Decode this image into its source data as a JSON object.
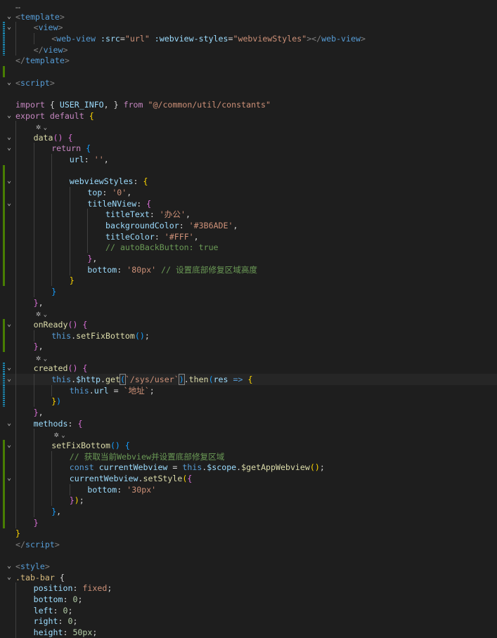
{
  "lines": [
    {
      "indent": 0,
      "fold": "",
      "gutter": "",
      "tokens": [
        {
          "t": "…",
          "c": "tok-punc"
        }
      ]
    },
    {
      "indent": 0,
      "fold": "⌄",
      "gutter": "",
      "tokens": [
        {
          "t": "<",
          "c": "tok-punc"
        },
        {
          "t": "template",
          "c": "tok-tag"
        },
        {
          "t": ">",
          "c": "tok-punc"
        }
      ]
    },
    {
      "indent": 1,
      "fold": "⌄",
      "gutter": "mod",
      "tokens": [
        {
          "t": "<",
          "c": "tok-punc"
        },
        {
          "t": "view",
          "c": "tok-tag"
        },
        {
          "t": ">",
          "c": "tok-punc"
        }
      ]
    },
    {
      "indent": 2,
      "fold": "",
      "gutter": "mod",
      "tokens": [
        {
          "t": "<",
          "c": "tok-punc"
        },
        {
          "t": "web-view",
          "c": "tok-tag"
        },
        {
          "t": " :src",
          "c": "tok-attr"
        },
        {
          "t": "=",
          "c": "tok-plain"
        },
        {
          "t": "\"url\"",
          "c": "tok-str"
        },
        {
          "t": " :webview-styles",
          "c": "tok-attr"
        },
        {
          "t": "=",
          "c": "tok-plain"
        },
        {
          "t": "\"webviewStyles\"",
          "c": "tok-str"
        },
        {
          "t": "></",
          "c": "tok-punc"
        },
        {
          "t": "web-view",
          "c": "tok-tag"
        },
        {
          "t": ">",
          "c": "tok-punc"
        }
      ]
    },
    {
      "indent": 1,
      "fold": "",
      "gutter": "mod",
      "tokens": [
        {
          "t": "</",
          "c": "tok-punc"
        },
        {
          "t": "view",
          "c": "tok-tag"
        },
        {
          "t": ">",
          "c": "tok-punc"
        }
      ]
    },
    {
      "indent": 0,
      "fold": "",
      "gutter": "",
      "tokens": [
        {
          "t": "</",
          "c": "tok-punc"
        },
        {
          "t": "template",
          "c": "tok-tag"
        },
        {
          "t": ">",
          "c": "tok-punc"
        }
      ]
    },
    {
      "indent": 0,
      "fold": "",
      "gutter": "add",
      "tokens": []
    },
    {
      "indent": 0,
      "fold": "⌄",
      "gutter": "",
      "tokens": [
        {
          "t": "<",
          "c": "tok-punc"
        },
        {
          "t": "script",
          "c": "tok-tag"
        },
        {
          "t": ">",
          "c": "tok-punc"
        }
      ]
    },
    {
      "indent": 0,
      "fold": "",
      "gutter": "",
      "tokens": []
    },
    {
      "indent": 0,
      "fold": "",
      "gutter": "",
      "tokens": [
        {
          "t": "import",
          "c": "tok-kw"
        },
        {
          "t": " { ",
          "c": "tok-plain"
        },
        {
          "t": "USER_INFO",
          "c": "tok-var"
        },
        {
          "t": ", } ",
          "c": "tok-plain"
        },
        {
          "t": "from",
          "c": "tok-kw"
        },
        {
          "t": " ",
          "c": "tok-plain"
        },
        {
          "t": "\"@/common/util/constants\"",
          "c": "tok-str"
        }
      ]
    },
    {
      "indent": 0,
      "fold": "⌄",
      "gutter": "",
      "tokens": [
        {
          "t": "export",
          "c": "tok-kw"
        },
        {
          "t": " ",
          "c": "tok-plain"
        },
        {
          "t": "default",
          "c": "tok-kw"
        },
        {
          "t": " ",
          "c": "tok-plain"
        },
        {
          "t": "{",
          "c": "tok-br1"
        }
      ]
    },
    {
      "indent": 1,
      "fold": "",
      "gutter": "",
      "lens": true,
      "tokens": []
    },
    {
      "indent": 1,
      "fold": "⌄",
      "gutter": "",
      "tokens": [
        {
          "t": "data",
          "c": "tok-fn"
        },
        {
          "t": "()",
          "c": "tok-br2"
        },
        {
          "t": " ",
          "c": "tok-plain"
        },
        {
          "t": "{",
          "c": "tok-br2"
        }
      ]
    },
    {
      "indent": 2,
      "fold": "⌄",
      "gutter": "",
      "tokens": [
        {
          "t": "return",
          "c": "tok-kw"
        },
        {
          "t": " ",
          "c": "tok-plain"
        },
        {
          "t": "{",
          "c": "tok-br3"
        }
      ]
    },
    {
      "indent": 3,
      "fold": "",
      "gutter": "",
      "tokens": [
        {
          "t": "url",
          "c": "tok-prop"
        },
        {
          "t": ": ",
          "c": "tok-plain"
        },
        {
          "t": "''",
          "c": "tok-str"
        },
        {
          "t": ",",
          "c": "tok-plain"
        }
      ]
    },
    {
      "indent": 3,
      "fold": "",
      "gutter": "add",
      "tokens": []
    },
    {
      "indent": 3,
      "fold": "⌄",
      "gutter": "add",
      "tokens": [
        {
          "t": "webviewStyles",
          "c": "tok-prop"
        },
        {
          "t": ": ",
          "c": "tok-plain"
        },
        {
          "t": "{",
          "c": "tok-br1"
        }
      ]
    },
    {
      "indent": 4,
      "fold": "",
      "gutter": "add",
      "tokens": [
        {
          "t": "top",
          "c": "tok-prop"
        },
        {
          "t": ": ",
          "c": "tok-plain"
        },
        {
          "t": "'0'",
          "c": "tok-str"
        },
        {
          "t": ",",
          "c": "tok-plain"
        }
      ]
    },
    {
      "indent": 4,
      "fold": "⌄",
      "gutter": "add",
      "tokens": [
        {
          "t": "titleNView",
          "c": "tok-prop"
        },
        {
          "t": ": ",
          "c": "tok-plain"
        },
        {
          "t": "{",
          "c": "tok-br2"
        }
      ]
    },
    {
      "indent": 5,
      "fold": "",
      "gutter": "add",
      "tokens": [
        {
          "t": "titleText",
          "c": "tok-prop"
        },
        {
          "t": ": ",
          "c": "tok-plain"
        },
        {
          "t": "'办公'",
          "c": "tok-str"
        },
        {
          "t": ",",
          "c": "tok-plain"
        }
      ]
    },
    {
      "indent": 5,
      "fold": "",
      "gutter": "add",
      "tokens": [
        {
          "t": "backgroundColor",
          "c": "tok-prop"
        },
        {
          "t": ": ",
          "c": "tok-plain"
        },
        {
          "t": "'#3B6ADE'",
          "c": "tok-str"
        },
        {
          "t": ",",
          "c": "tok-plain"
        }
      ]
    },
    {
      "indent": 5,
      "fold": "",
      "gutter": "add",
      "tokens": [
        {
          "t": "titleColor",
          "c": "tok-prop"
        },
        {
          "t": ": ",
          "c": "tok-plain"
        },
        {
          "t": "'#FFF'",
          "c": "tok-str"
        },
        {
          "t": ",",
          "c": "tok-plain"
        }
      ]
    },
    {
      "indent": 5,
      "fold": "",
      "gutter": "add",
      "tokens": [
        {
          "t": "// autoBackButton: true",
          "c": "tok-com"
        }
      ]
    },
    {
      "indent": 4,
      "fold": "",
      "gutter": "add",
      "tokens": [
        {
          "t": "}",
          "c": "tok-br2"
        },
        {
          "t": ",",
          "c": "tok-plain"
        }
      ]
    },
    {
      "indent": 4,
      "fold": "",
      "gutter": "add",
      "tokens": [
        {
          "t": "bottom",
          "c": "tok-prop"
        },
        {
          "t": ": ",
          "c": "tok-plain"
        },
        {
          "t": "'80px'",
          "c": "tok-str"
        },
        {
          "t": " ",
          "c": "tok-plain"
        },
        {
          "t": "// 设置底部修复区域高度",
          "c": "tok-com"
        }
      ]
    },
    {
      "indent": 3,
      "fold": "",
      "gutter": "add",
      "tokens": [
        {
          "t": "}",
          "c": "tok-br1"
        }
      ]
    },
    {
      "indent": 2,
      "fold": "",
      "gutter": "",
      "tokens": [
        {
          "t": "}",
          "c": "tok-br3"
        }
      ]
    },
    {
      "indent": 1,
      "fold": "",
      "gutter": "",
      "tokens": [
        {
          "t": "}",
          "c": "tok-br2"
        },
        {
          "t": ",",
          "c": "tok-plain"
        }
      ]
    },
    {
      "indent": 1,
      "fold": "",
      "gutter": "",
      "lens": true,
      "tokens": []
    },
    {
      "indent": 1,
      "fold": "⌄",
      "gutter": "add",
      "tokens": [
        {
          "t": "onReady",
          "c": "tok-fn"
        },
        {
          "t": "()",
          "c": "tok-br2"
        },
        {
          "t": " ",
          "c": "tok-plain"
        },
        {
          "t": "{",
          "c": "tok-br2"
        }
      ]
    },
    {
      "indent": 2,
      "fold": "",
      "gutter": "add",
      "tokens": [
        {
          "t": "this",
          "c": "tok-kwb"
        },
        {
          "t": ".",
          "c": "tok-plain"
        },
        {
          "t": "setFixBottom",
          "c": "tok-fn"
        },
        {
          "t": "()",
          "c": "tok-br3"
        },
        {
          "t": ";",
          "c": "tok-plain"
        }
      ]
    },
    {
      "indent": 1,
      "fold": "",
      "gutter": "add",
      "tokens": [
        {
          "t": "}",
          "c": "tok-br2"
        },
        {
          "t": ",",
          "c": "tok-plain"
        }
      ]
    },
    {
      "indent": 1,
      "fold": "",
      "gutter": "",
      "lens": true,
      "tokens": []
    },
    {
      "indent": 1,
      "fold": "⌄",
      "gutter": "mod",
      "tokens": [
        {
          "t": "created",
          "c": "tok-fn"
        },
        {
          "t": "()",
          "c": "tok-br2"
        },
        {
          "t": " ",
          "c": "tok-plain"
        },
        {
          "t": "{",
          "c": "tok-br2"
        }
      ]
    },
    {
      "indent": 2,
      "fold": "⌄",
      "gutter": "mod",
      "cursor": true,
      "tokens": [
        {
          "t": "this",
          "c": "tok-kwb"
        },
        {
          "t": ".",
          "c": "tok-plain"
        },
        {
          "t": "$http",
          "c": "tok-var"
        },
        {
          "t": ".",
          "c": "tok-plain"
        },
        {
          "t": "get",
          "c": "tok-fn"
        },
        {
          "t": "(",
          "c": "tok-br3",
          "box": true
        },
        {
          "t": "`/sys/user`",
          "c": "tok-str"
        },
        {
          "t": ")",
          "c": "tok-br3",
          "box": true
        },
        {
          "t": ".",
          "c": "tok-plain"
        },
        {
          "t": "then",
          "c": "tok-fn"
        },
        {
          "t": "(",
          "c": "tok-br3"
        },
        {
          "t": "res",
          "c": "tok-var"
        },
        {
          "t": " ",
          "c": "tok-plain"
        },
        {
          "t": "=>",
          "c": "tok-kwb"
        },
        {
          "t": " ",
          "c": "tok-plain"
        },
        {
          "t": "{",
          "c": "tok-br1"
        }
      ]
    },
    {
      "indent": 3,
      "fold": "",
      "gutter": "mod",
      "tokens": [
        {
          "t": "this",
          "c": "tok-kwb"
        },
        {
          "t": ".",
          "c": "tok-plain"
        },
        {
          "t": "url",
          "c": "tok-var"
        },
        {
          "t": " = ",
          "c": "tok-plain"
        },
        {
          "t": "`地址`",
          "c": "tok-str"
        },
        {
          "t": ";",
          "c": "tok-plain"
        }
      ]
    },
    {
      "indent": 2,
      "fold": "",
      "gutter": "mod",
      "tokens": [
        {
          "t": "}",
          "c": "tok-br1"
        },
        {
          "t": ")",
          "c": "tok-br3"
        }
      ]
    },
    {
      "indent": 1,
      "fold": "",
      "gutter": "",
      "tokens": [
        {
          "t": "}",
          "c": "tok-br2"
        },
        {
          "t": ",",
          "c": "tok-plain"
        }
      ]
    },
    {
      "indent": 1,
      "fold": "⌄",
      "gutter": "",
      "tokens": [
        {
          "t": "methods",
          "c": "tok-prop"
        },
        {
          "t": ": ",
          "c": "tok-plain"
        },
        {
          "t": "{",
          "c": "tok-br2"
        }
      ]
    },
    {
      "indent": 2,
      "fold": "",
      "gutter": "",
      "lens": true,
      "tokens": []
    },
    {
      "indent": 2,
      "fold": "⌄",
      "gutter": "add",
      "tokens": [
        {
          "t": "setFixBottom",
          "c": "tok-fn"
        },
        {
          "t": "()",
          "c": "tok-br3"
        },
        {
          "t": " ",
          "c": "tok-plain"
        },
        {
          "t": "{",
          "c": "tok-br3"
        }
      ]
    },
    {
      "indent": 3,
      "fold": "",
      "gutter": "add",
      "tokens": [
        {
          "t": "// 获取当前Webview并设置底部修复区域",
          "c": "tok-com"
        }
      ]
    },
    {
      "indent": 3,
      "fold": "",
      "gutter": "add",
      "tokens": [
        {
          "t": "const",
          "c": "tok-kwb"
        },
        {
          "t": " ",
          "c": "tok-plain"
        },
        {
          "t": "currentWebview",
          "c": "tok-var"
        },
        {
          "t": " = ",
          "c": "tok-plain"
        },
        {
          "t": "this",
          "c": "tok-kwb"
        },
        {
          "t": ".",
          "c": "tok-plain"
        },
        {
          "t": "$scope",
          "c": "tok-var"
        },
        {
          "t": ".",
          "c": "tok-plain"
        },
        {
          "t": "$getAppWebview",
          "c": "tok-fn"
        },
        {
          "t": "()",
          "c": "tok-br1"
        },
        {
          "t": ";",
          "c": "tok-plain"
        }
      ]
    },
    {
      "indent": 3,
      "fold": "⌄",
      "gutter": "add",
      "tokens": [
        {
          "t": "currentWebview",
          "c": "tok-var"
        },
        {
          "t": ".",
          "c": "tok-plain"
        },
        {
          "t": "setStyle",
          "c": "tok-fn"
        },
        {
          "t": "(",
          "c": "tok-br1"
        },
        {
          "t": "{",
          "c": "tok-br2"
        }
      ]
    },
    {
      "indent": 4,
      "fold": "",
      "gutter": "add",
      "tokens": [
        {
          "t": "bottom",
          "c": "tok-prop"
        },
        {
          "t": ": ",
          "c": "tok-plain"
        },
        {
          "t": "'30px'",
          "c": "tok-str"
        }
      ]
    },
    {
      "indent": 3,
      "fold": "",
      "gutter": "add",
      "tokens": [
        {
          "t": "}",
          "c": "tok-br2"
        },
        {
          "t": ")",
          "c": "tok-br1"
        },
        {
          "t": ";",
          "c": "tok-plain"
        }
      ]
    },
    {
      "indent": 2,
      "fold": "",
      "gutter": "add",
      "tokens": [
        {
          "t": "}",
          "c": "tok-br3"
        },
        {
          "t": ",",
          "c": "tok-plain"
        }
      ]
    },
    {
      "indent": 1,
      "fold": "",
      "gutter": "add",
      "tokens": [
        {
          "t": "}",
          "c": "tok-br2"
        }
      ]
    },
    {
      "indent": 0,
      "fold": "",
      "gutter": "",
      "tokens": [
        {
          "t": "}",
          "c": "tok-br1"
        }
      ]
    },
    {
      "indent": 0,
      "fold": "",
      "gutter": "",
      "tokens": [
        {
          "t": "</",
          "c": "tok-punc"
        },
        {
          "t": "script",
          "c": "tok-tag"
        },
        {
          "t": ">",
          "c": "tok-punc"
        }
      ]
    },
    {
      "indent": 0,
      "fold": "",
      "gutter": "",
      "tokens": []
    },
    {
      "indent": 0,
      "fold": "⌄",
      "gutter": "",
      "tokens": [
        {
          "t": "<",
          "c": "tok-punc"
        },
        {
          "t": "style",
          "c": "tok-tag"
        },
        {
          "t": ">",
          "c": "tok-punc"
        }
      ]
    },
    {
      "indent": 0,
      "fold": "⌄",
      "gutter": "",
      "tokens": [
        {
          "t": ".tab-bar",
          "c": "tok-sel"
        },
        {
          "t": " {",
          "c": "tok-plain"
        }
      ]
    },
    {
      "indent": 1,
      "fold": "",
      "gutter": "",
      "tokens": [
        {
          "t": "position",
          "c": "tok-prop-css"
        },
        {
          "t": ": ",
          "c": "tok-plain"
        },
        {
          "t": "fixed",
          "c": "tok-val"
        },
        {
          "t": ";",
          "c": "tok-plain"
        }
      ]
    },
    {
      "indent": 1,
      "fold": "",
      "gutter": "",
      "tokens": [
        {
          "t": "bottom",
          "c": "tok-prop-css"
        },
        {
          "t": ": ",
          "c": "tok-plain"
        },
        {
          "t": "0",
          "c": "tok-num"
        },
        {
          "t": ";",
          "c": "tok-plain"
        }
      ]
    },
    {
      "indent": 1,
      "fold": "",
      "gutter": "",
      "tokens": [
        {
          "t": "left",
          "c": "tok-prop-css"
        },
        {
          "t": ": ",
          "c": "tok-plain"
        },
        {
          "t": "0",
          "c": "tok-num"
        },
        {
          "t": ";",
          "c": "tok-plain"
        }
      ]
    },
    {
      "indent": 1,
      "fold": "",
      "gutter": "",
      "tokens": [
        {
          "t": "right",
          "c": "tok-prop-css"
        },
        {
          "t": ": ",
          "c": "tok-plain"
        },
        {
          "t": "0",
          "c": "tok-num"
        },
        {
          "t": ";",
          "c": "tok-plain"
        }
      ]
    },
    {
      "indent": 1,
      "fold": "",
      "gutter": "",
      "tokens": [
        {
          "t": "height",
          "c": "tok-prop-css"
        },
        {
          "t": ": ",
          "c": "tok-plain"
        },
        {
          "t": "50px",
          "c": "tok-num"
        },
        {
          "t": ";",
          "c": "tok-plain"
        }
      ]
    }
  ],
  "code_lens_icon": "copilot-sparkle-icon",
  "fold_icon": "chevron-down-icon",
  "colors": {
    "background": "#1e1e1e",
    "modified_bar": "#1b81a8",
    "added_bar": "#487e02"
  }
}
